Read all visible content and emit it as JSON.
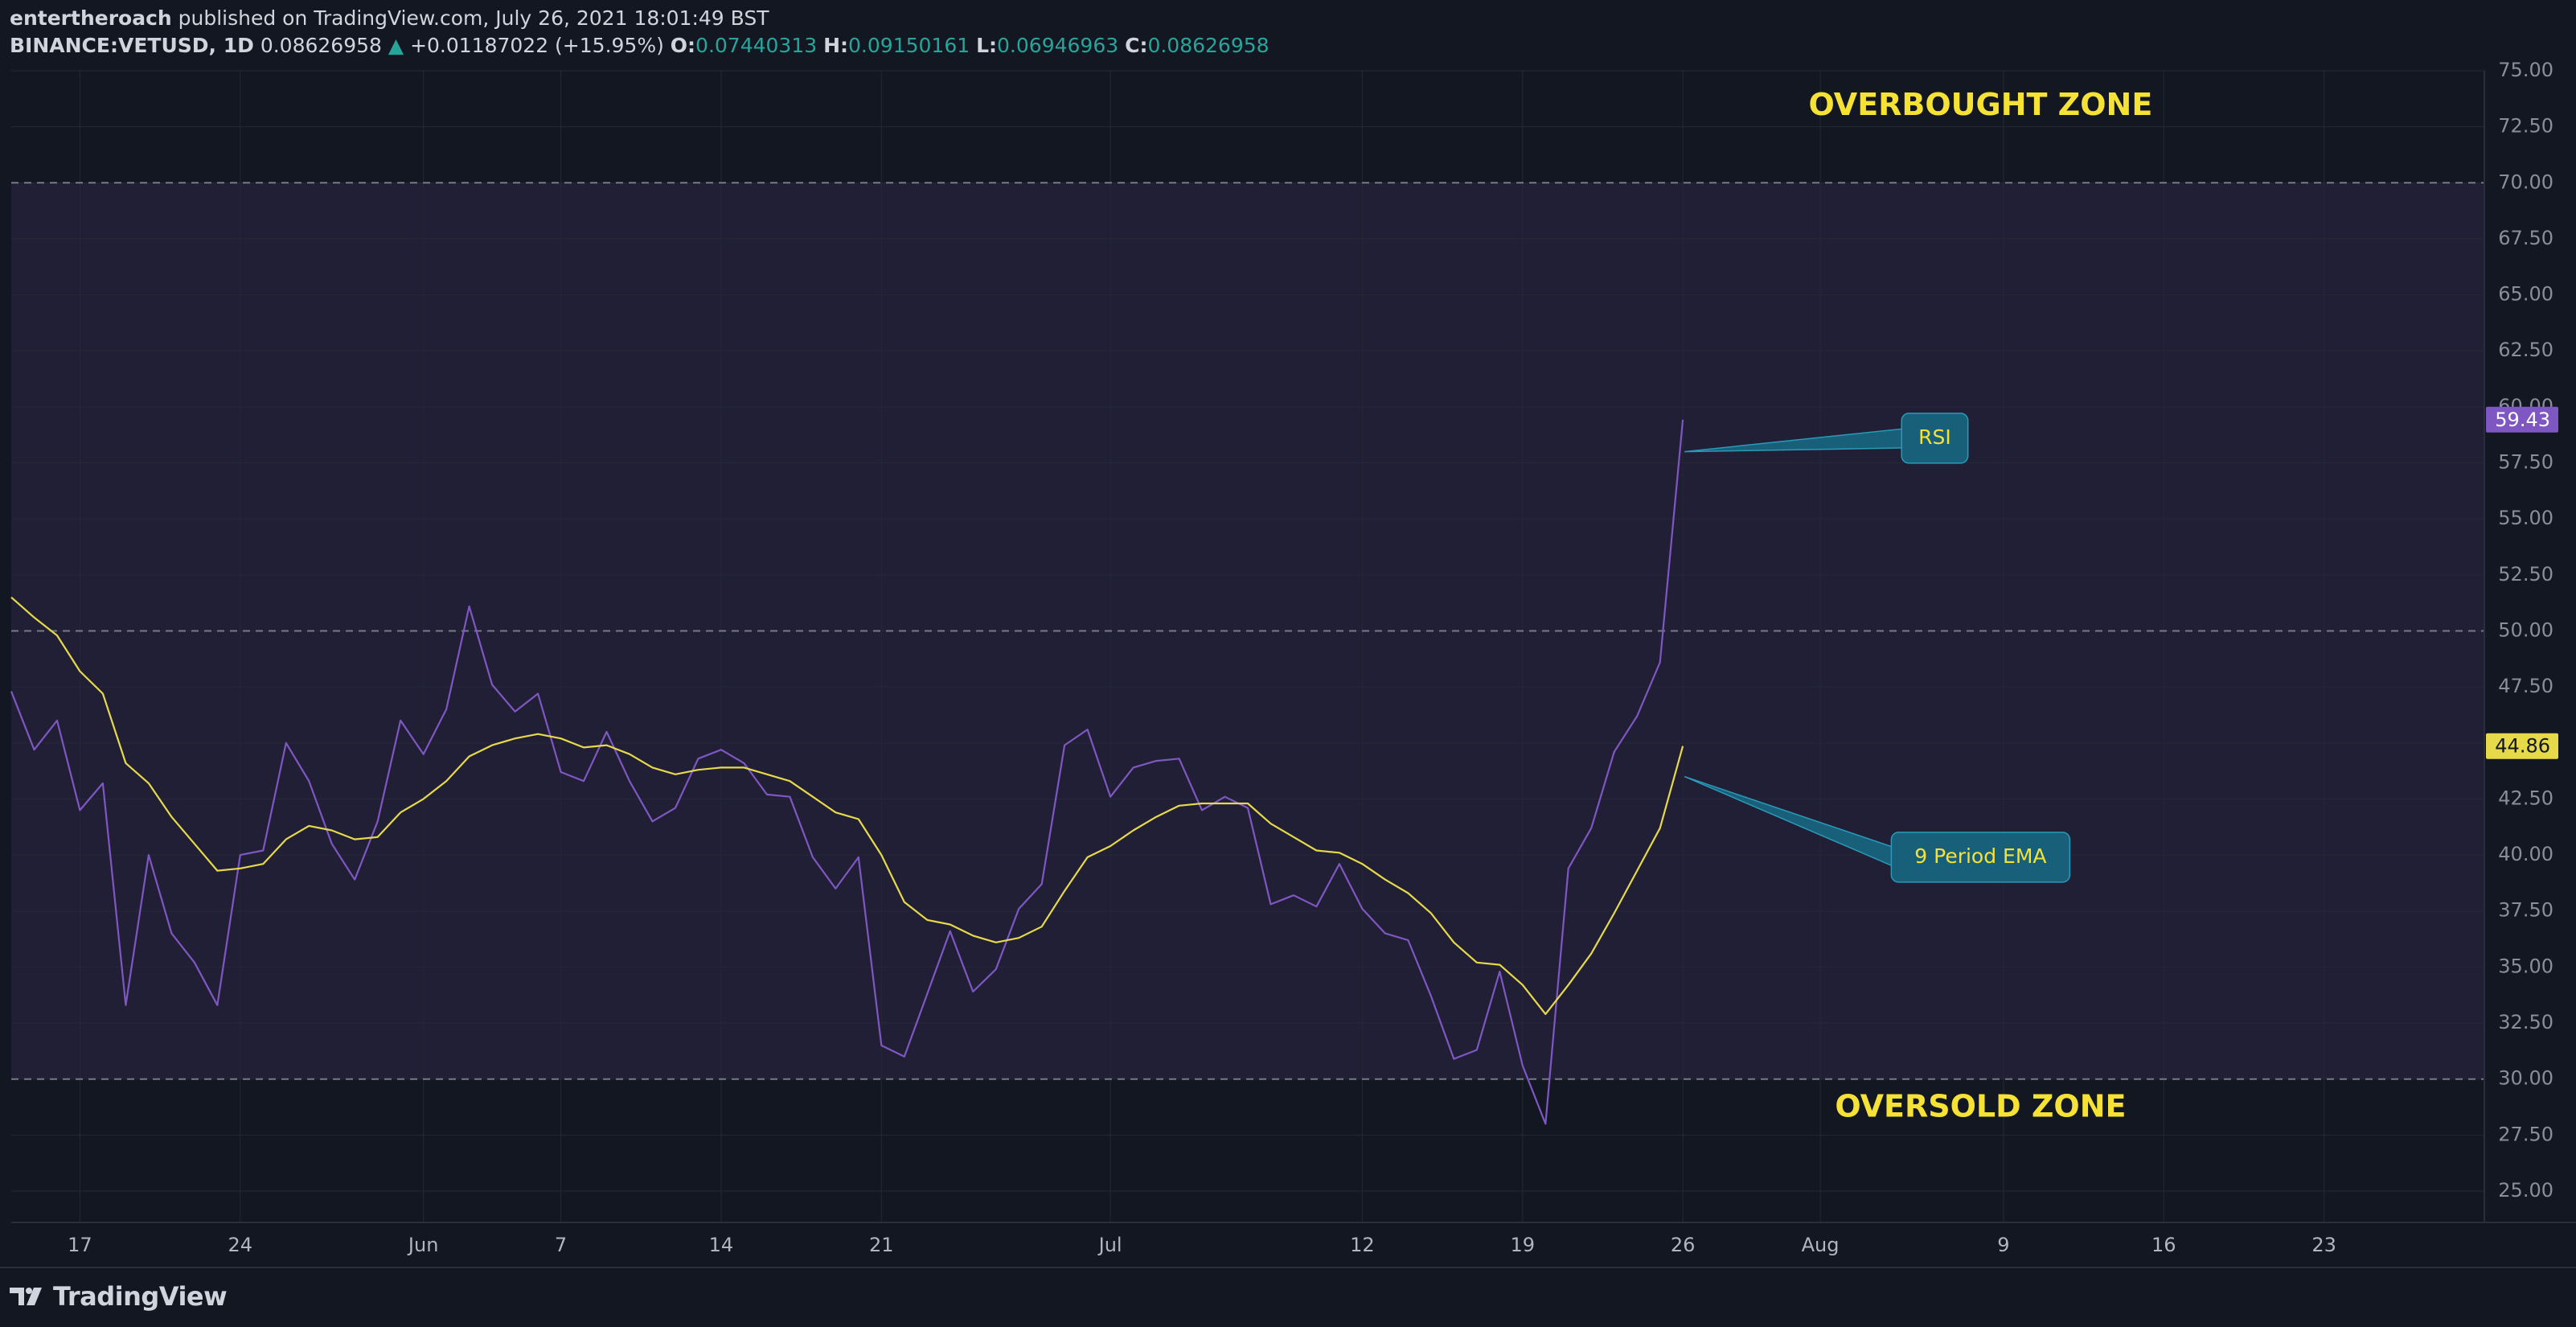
{
  "header": {
    "author": "entertheroach",
    "published": "published on TradingView.com, July 26, 2021 18:01:49 BST"
  },
  "legend": {
    "symbol": "BINANCE:VETUSD, 1D",
    "price": "0.08626958",
    "arrow": "▲",
    "change": "+0.01187022 (+15.95%)",
    "open_label": "O:",
    "open": "0.07440313",
    "high_label": "H:",
    "high": "0.09150161",
    "low_label": "L:",
    "low": "0.06946963",
    "close_label": "C:",
    "close": "0.08626958"
  },
  "footer": {
    "brand": "TradingView"
  },
  "colors": {
    "background": "#131722",
    "zone_fill": "#211f35",
    "rsi": "#7e57c2",
    "ema": "#e6d94a",
    "annotation_fill": "#18607a",
    "annotation_border": "#2a9ab8",
    "zone_text": "#f5e234",
    "grid": "#252836",
    "axis_text": "#8b8e99"
  },
  "chart_data": {
    "type": "line",
    "x_unit": "day",
    "x": [
      "2021-05-14",
      "2021-05-15",
      "2021-05-16",
      "2021-05-17",
      "2021-05-18",
      "2021-05-19",
      "2021-05-20",
      "2021-05-21",
      "2021-05-22",
      "2021-05-23",
      "2021-05-24",
      "2021-05-25",
      "2021-05-26",
      "2021-05-27",
      "2021-05-28",
      "2021-05-29",
      "2021-05-30",
      "2021-05-31",
      "2021-06-01",
      "2021-06-02",
      "2021-06-03",
      "2021-06-04",
      "2021-06-05",
      "2021-06-06",
      "2021-06-07",
      "2021-06-08",
      "2021-06-09",
      "2021-06-10",
      "2021-06-11",
      "2021-06-12",
      "2021-06-13",
      "2021-06-14",
      "2021-06-15",
      "2021-06-16",
      "2021-06-17",
      "2021-06-18",
      "2021-06-19",
      "2021-06-20",
      "2021-06-21",
      "2021-06-22",
      "2021-06-23",
      "2021-06-24",
      "2021-06-25",
      "2021-06-26",
      "2021-06-27",
      "2021-06-28",
      "2021-06-29",
      "2021-06-30",
      "2021-07-01",
      "2021-07-02",
      "2021-07-03",
      "2021-07-04",
      "2021-07-05",
      "2021-07-06",
      "2021-07-07",
      "2021-07-08",
      "2021-07-09",
      "2021-07-10",
      "2021-07-11",
      "2021-07-12",
      "2021-07-13",
      "2021-07-14",
      "2021-07-15",
      "2021-07-16",
      "2021-07-17",
      "2021-07-18",
      "2021-07-19",
      "2021-07-20",
      "2021-07-21",
      "2021-07-22",
      "2021-07-23",
      "2021-07-24",
      "2021-07-25",
      "2021-07-26"
    ],
    "series": [
      {
        "name": "RSI",
        "values": [
          47.3,
          44.7,
          46.0,
          42.0,
          43.2,
          33.3,
          40.0,
          36.5,
          35.2,
          33.3,
          40.0,
          40.2,
          45.0,
          43.3,
          40.5,
          38.9,
          41.5,
          46.0,
          44.5,
          46.5,
          51.1,
          47.6,
          46.4,
          47.2,
          43.7,
          43.3,
          45.5,
          43.3,
          41.5,
          42.1,
          44.3,
          44.7,
          44.1,
          42.7,
          42.6,
          39.9,
          38.5,
          39.9,
          31.5,
          31.0,
          33.8,
          36.6,
          33.9,
          34.9,
          37.6,
          38.7,
          44.9,
          45.6,
          42.6,
          43.9,
          44.2,
          44.3,
          42.0,
          42.6,
          42.1,
          37.8,
          38.2,
          37.7,
          39.6,
          37.6,
          36.5,
          36.2,
          33.7,
          30.9,
          31.3,
          34.8,
          30.6,
          28.0,
          39.4,
          41.2,
          44.6,
          46.2,
          48.6,
          59.43
        ]
      },
      {
        "name": "9 Period EMA",
        "values": [
          51.5,
          50.6,
          49.8,
          48.2,
          47.2,
          44.1,
          43.2,
          41.7,
          40.5,
          39.3,
          39.4,
          39.6,
          40.7,
          41.3,
          41.1,
          40.7,
          40.8,
          41.9,
          42.5,
          43.3,
          44.4,
          44.9,
          45.2,
          45.4,
          45.2,
          44.8,
          44.9,
          44.5,
          43.9,
          43.6,
          43.8,
          43.9,
          43.9,
          43.6,
          43.3,
          42.6,
          41.9,
          41.6,
          40.0,
          37.9,
          37.1,
          36.9,
          36.4,
          36.1,
          36.3,
          36.8,
          38.4,
          39.9,
          40.4,
          41.1,
          41.7,
          42.2,
          42.3,
          42.3,
          42.3,
          41.4,
          40.8,
          40.2,
          40.1,
          39.6,
          38.9,
          38.3,
          37.4,
          36.1,
          35.2,
          35.1,
          34.2,
          32.9,
          34.2,
          35.6,
          37.4,
          39.3,
          41.2,
          44.86
        ]
      }
    ],
    "last_values": {
      "rsi": "59.43",
      "ema": "44.86"
    },
    "ylim": [
      23.6,
      75.0
    ],
    "y_ticks": [
      "75.00",
      "72.50",
      "70.00",
      "67.50",
      "65.00",
      "62.50",
      "60.00",
      "57.50",
      "55.00",
      "52.50",
      "50.00",
      "47.50",
      "45.00",
      "42.50",
      "40.00",
      "37.50",
      "35.00",
      "32.50",
      "30.00",
      "27.50",
      "25.00"
    ],
    "x_ticks": [
      {
        "label": "17",
        "date": "2021-05-17"
      },
      {
        "label": "24",
        "date": "2021-05-24"
      },
      {
        "label": "Jun",
        "date": "2021-06-01"
      },
      {
        "label": "7",
        "date": "2021-06-07"
      },
      {
        "label": "14",
        "date": "2021-06-14"
      },
      {
        "label": "21",
        "date": "2021-06-21"
      },
      {
        "label": "Jul",
        "date": "2021-07-01"
      },
      {
        "label": "12",
        "date": "2021-07-12"
      },
      {
        "label": "19",
        "date": "2021-07-19"
      },
      {
        "label": "26",
        "date": "2021-07-26"
      },
      {
        "label": "Aug",
        "date": "2021-08-01"
      },
      {
        "label": "9",
        "date": "2021-08-09"
      },
      {
        "label": "16",
        "date": "2021-08-16"
      },
      {
        "label": "23",
        "date": "2021-08-23"
      }
    ],
    "xlim": [
      "2021-05-14",
      "2021-08-30"
    ],
    "levels": [
      70,
      50,
      30
    ],
    "zone_fill_range": [
      30,
      70
    ],
    "zone_labels": [
      {
        "text": "OVERBOUGHT ZONE",
        "date": "2021-08-08",
        "y": 73.4
      },
      {
        "text": "OVERSOLD ZONE",
        "date": "2021-08-08",
        "y": 28.7
      }
    ],
    "callouts": [
      {
        "text": "RSI",
        "date": "2021-08-06",
        "y": 58.6,
        "tip_y": 58.0,
        "series": "RSI"
      },
      {
        "text": "9 Period EMA",
        "date": "2021-08-08",
        "y": 39.9,
        "tip_y": 43.5,
        "series": "9 Period EMA"
      }
    ],
    "grid": true
  }
}
